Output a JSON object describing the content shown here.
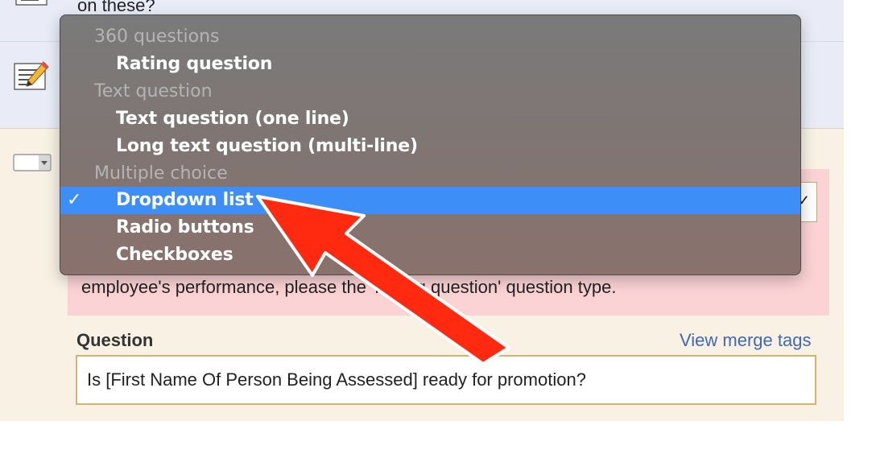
{
  "background_rows": {
    "partial_text": "on these?"
  },
  "alert": {
    "text": "employee's performance, please      the 'Rating question' question type."
  },
  "question": {
    "label": "Question",
    "merge_link": "View merge tags",
    "value": "Is [First Name Of Person Being Assessed] ready for promotion?"
  },
  "type_select": {
    "chevron": "✓"
  },
  "dropdown": {
    "groups": [
      {
        "header": "360 questions",
        "items": [
          {
            "label": "Rating question"
          }
        ]
      },
      {
        "header": "Text question",
        "items": [
          {
            "label": "Text question (one line)"
          },
          {
            "label": "Long text question (multi-line)"
          }
        ]
      },
      {
        "header": "Multiple choice",
        "items": [
          {
            "label": "Dropdown list",
            "selected": true
          },
          {
            "label": "Radio buttons"
          },
          {
            "label": "Checkboxes"
          }
        ]
      }
    ],
    "check_glyph": "✓"
  },
  "colors": {
    "menu_highlight": "#3d8ef7",
    "annotation_arrow": "#ff2a10",
    "link": "#3f69b0",
    "alert_bg": "#fbd3d4"
  },
  "icons": [
    "document-edit-icon",
    "select-field-icon",
    "checkmark-icon",
    "annotation-arrow-icon"
  ]
}
